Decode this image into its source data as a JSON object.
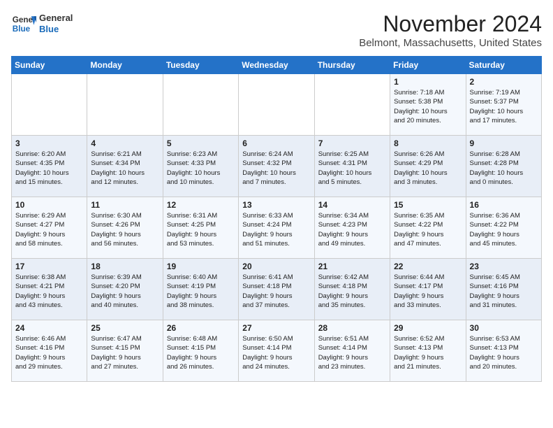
{
  "header": {
    "logo_general": "General",
    "logo_blue": "Blue",
    "month_title": "November 2024",
    "location": "Belmont, Massachusetts, United States"
  },
  "weekdays": [
    "Sunday",
    "Monday",
    "Tuesday",
    "Wednesday",
    "Thursday",
    "Friday",
    "Saturday"
  ],
  "weeks": [
    [
      {
        "day": "",
        "info": ""
      },
      {
        "day": "",
        "info": ""
      },
      {
        "day": "",
        "info": ""
      },
      {
        "day": "",
        "info": ""
      },
      {
        "day": "",
        "info": ""
      },
      {
        "day": "1",
        "info": "Sunrise: 7:18 AM\nSunset: 5:38 PM\nDaylight: 10 hours\nand 20 minutes."
      },
      {
        "day": "2",
        "info": "Sunrise: 7:19 AM\nSunset: 5:37 PM\nDaylight: 10 hours\nand 17 minutes."
      }
    ],
    [
      {
        "day": "3",
        "info": "Sunrise: 6:20 AM\nSunset: 4:35 PM\nDaylight: 10 hours\nand 15 minutes."
      },
      {
        "day": "4",
        "info": "Sunrise: 6:21 AM\nSunset: 4:34 PM\nDaylight: 10 hours\nand 12 minutes."
      },
      {
        "day": "5",
        "info": "Sunrise: 6:23 AM\nSunset: 4:33 PM\nDaylight: 10 hours\nand 10 minutes."
      },
      {
        "day": "6",
        "info": "Sunrise: 6:24 AM\nSunset: 4:32 PM\nDaylight: 10 hours\nand 7 minutes."
      },
      {
        "day": "7",
        "info": "Sunrise: 6:25 AM\nSunset: 4:31 PM\nDaylight: 10 hours\nand 5 minutes."
      },
      {
        "day": "8",
        "info": "Sunrise: 6:26 AM\nSunset: 4:29 PM\nDaylight: 10 hours\nand 3 minutes."
      },
      {
        "day": "9",
        "info": "Sunrise: 6:28 AM\nSunset: 4:28 PM\nDaylight: 10 hours\nand 0 minutes."
      }
    ],
    [
      {
        "day": "10",
        "info": "Sunrise: 6:29 AM\nSunset: 4:27 PM\nDaylight: 9 hours\nand 58 minutes."
      },
      {
        "day": "11",
        "info": "Sunrise: 6:30 AM\nSunset: 4:26 PM\nDaylight: 9 hours\nand 56 minutes."
      },
      {
        "day": "12",
        "info": "Sunrise: 6:31 AM\nSunset: 4:25 PM\nDaylight: 9 hours\nand 53 minutes."
      },
      {
        "day": "13",
        "info": "Sunrise: 6:33 AM\nSunset: 4:24 PM\nDaylight: 9 hours\nand 51 minutes."
      },
      {
        "day": "14",
        "info": "Sunrise: 6:34 AM\nSunset: 4:23 PM\nDaylight: 9 hours\nand 49 minutes."
      },
      {
        "day": "15",
        "info": "Sunrise: 6:35 AM\nSunset: 4:22 PM\nDaylight: 9 hours\nand 47 minutes."
      },
      {
        "day": "16",
        "info": "Sunrise: 6:36 AM\nSunset: 4:22 PM\nDaylight: 9 hours\nand 45 minutes."
      }
    ],
    [
      {
        "day": "17",
        "info": "Sunrise: 6:38 AM\nSunset: 4:21 PM\nDaylight: 9 hours\nand 43 minutes."
      },
      {
        "day": "18",
        "info": "Sunrise: 6:39 AM\nSunset: 4:20 PM\nDaylight: 9 hours\nand 40 minutes."
      },
      {
        "day": "19",
        "info": "Sunrise: 6:40 AM\nSunset: 4:19 PM\nDaylight: 9 hours\nand 38 minutes."
      },
      {
        "day": "20",
        "info": "Sunrise: 6:41 AM\nSunset: 4:18 PM\nDaylight: 9 hours\nand 37 minutes."
      },
      {
        "day": "21",
        "info": "Sunrise: 6:42 AM\nSunset: 4:18 PM\nDaylight: 9 hours\nand 35 minutes."
      },
      {
        "day": "22",
        "info": "Sunrise: 6:44 AM\nSunset: 4:17 PM\nDaylight: 9 hours\nand 33 minutes."
      },
      {
        "day": "23",
        "info": "Sunrise: 6:45 AM\nSunset: 4:16 PM\nDaylight: 9 hours\nand 31 minutes."
      }
    ],
    [
      {
        "day": "24",
        "info": "Sunrise: 6:46 AM\nSunset: 4:16 PM\nDaylight: 9 hours\nand 29 minutes."
      },
      {
        "day": "25",
        "info": "Sunrise: 6:47 AM\nSunset: 4:15 PM\nDaylight: 9 hours\nand 27 minutes."
      },
      {
        "day": "26",
        "info": "Sunrise: 6:48 AM\nSunset: 4:15 PM\nDaylight: 9 hours\nand 26 minutes."
      },
      {
        "day": "27",
        "info": "Sunrise: 6:50 AM\nSunset: 4:14 PM\nDaylight: 9 hours\nand 24 minutes."
      },
      {
        "day": "28",
        "info": "Sunrise: 6:51 AM\nSunset: 4:14 PM\nDaylight: 9 hours\nand 23 minutes."
      },
      {
        "day": "29",
        "info": "Sunrise: 6:52 AM\nSunset: 4:13 PM\nDaylight: 9 hours\nand 21 minutes."
      },
      {
        "day": "30",
        "info": "Sunrise: 6:53 AM\nSunset: 4:13 PM\nDaylight: 9 hours\nand 20 minutes."
      }
    ]
  ]
}
